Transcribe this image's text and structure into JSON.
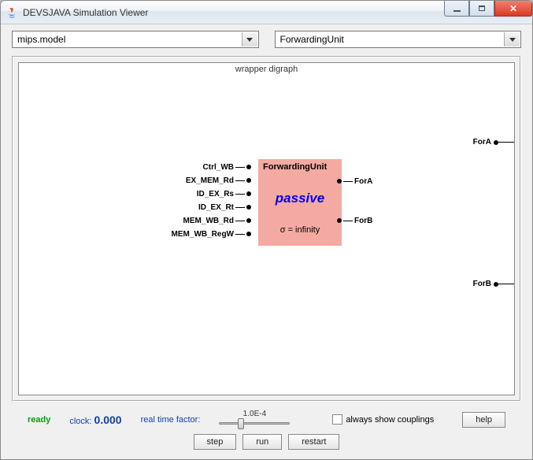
{
  "window": {
    "title": "DEVSJAVA Simulation Viewer"
  },
  "selectors": {
    "model": "mips.model",
    "view": "ForwardingUnit"
  },
  "canvas": {
    "title": "wrapper digraph",
    "block": {
      "name": "ForwardingUnit",
      "state": "passive",
      "sigma": "σ = infinity"
    },
    "inputs": [
      "Ctrl_WB",
      "EX_MEM_Rd",
      "ID_EX_Rs",
      "ID_EX_Rt",
      "MEM_WB_Rd",
      "MEM_WB_RegW"
    ],
    "outputs": [
      "ForA",
      "ForB"
    ],
    "ext_outputs": [
      "ForA",
      "ForB"
    ]
  },
  "status": {
    "ready": "ready",
    "clock_label": "clock:",
    "clock_value": "0.000",
    "rtf_label": "real time factor:",
    "rtf_value": "1.0E-4",
    "checkbox_label": "always show couplings"
  },
  "buttons": {
    "help": "help",
    "step": "step",
    "run": "run",
    "restart": "restart"
  }
}
